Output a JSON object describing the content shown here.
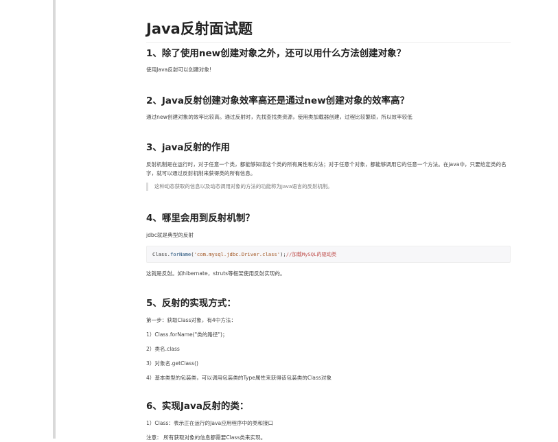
{
  "article": {
    "title": "Java反射面试题",
    "sections": [
      {
        "heading": "1、除了使用new创建对象之外，还可以用什么方法创建对象？",
        "text": "使用Java反射可以创建对象!"
      },
      {
        "heading": "2、Java反射创建对象效率高还是通过new创建对象的效率高？",
        "text": "通过new创建对象的效率比较高。通过反射时，先找查找类资源，使用类加载器创建，过程比较繁琐，所以效率较低"
      },
      {
        "heading": "3、java反射的作用",
        "text": "反射机制是在运行时，对于任意一个类，都能够知道这个类的所有属性和方法；对于任意个对象，都能够调用它的任意一个方法。在java中，只要给定类的名字，就可以通过反射机制来获得类的所有信息。",
        "quote": "这种动态获取的信息以及动态调用对象的方法的功能称为Java语言的反射机制。"
      },
      {
        "heading": "4、哪里会用到反射机制？",
        "text": "jdbc就是典型的反射",
        "code": {
          "prefix": "Class.",
          "fn": "forName",
          "open": "(",
          "str": "'com.mysql.jdbc.Driver.class'",
          "close": ");",
          "comment": "//加载MySQL的驱动类"
        },
        "after": "这就是反射。如hibernate，struts等框架使用反射实现的。"
      },
      {
        "heading": "5、反射的实现方式：",
        "lines": [
          "第一步：获取Class对象，有4中方法：",
          "1）Class.forName(\"类的路径\")；",
          "2）类名.class",
          "3）对象名.getClass()",
          "4）基本类型的包装类，可以调用包装类的Type属性来获得该包装类的Class对象"
        ]
      },
      {
        "heading": "6、实现Java反射的类：",
        "lines": [
          "1）Class：表示正在运行的Java应用程序中的类和接口",
          "注意： 所有获取对象的信息都需要Class类来实现。"
        ]
      }
    ]
  }
}
